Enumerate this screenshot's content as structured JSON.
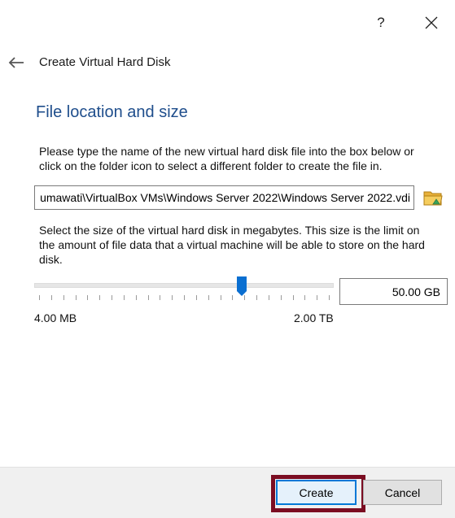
{
  "titlebar": {
    "help_label": "?",
    "close_label": "✕"
  },
  "header": {
    "title": "Create Virtual Hard Disk"
  },
  "section": {
    "title": "File location and size"
  },
  "file_location": {
    "description": "Please type the name of the new virtual hard disk file into the box below or click on the folder icon to select a different folder to create the file in.",
    "path_value": "umawati\\VirtualBox VMs\\Windows Server 2022\\Windows Server 2022.vdi"
  },
  "size": {
    "description": "Select the size of the virtual hard disk in megabytes. This size is the limit on the amount of file data that a virtual machine will be able to store on the hard disk.",
    "slider_position": 0.7,
    "min_label": "4.00 MB",
    "max_label": "2.00 TB",
    "value": "50.00 GB"
  },
  "buttons": {
    "create_label": "Create",
    "cancel_label": "Cancel"
  },
  "colors": {
    "title_blue": "#1f4e8c",
    "slider_blue": "#0a6fd1",
    "highlight": "#7b0d22",
    "folder_yellow": "#e8b13a",
    "folder_green": "#3aa35a"
  }
}
